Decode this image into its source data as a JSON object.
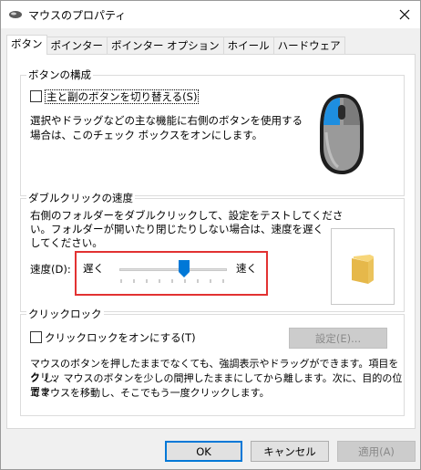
{
  "window": {
    "title": "マウスのプロパティ"
  },
  "tabs": [
    "ボタン",
    "ポインター",
    "ポインター オプション",
    "ホイール",
    "ハードウェア"
  ],
  "button_config": {
    "group_title": "ボタンの構成",
    "swap_checkbox_label": "主と副のボタンを切り替える(S)",
    "swap_checked": false,
    "description_line1": "選択やドラッグなどの主な機能に右側のボタンを使用する",
    "description_line2": "場合は、このチェック ボックスをオンにします。"
  },
  "double_click": {
    "group_title": "ダブルクリックの速度",
    "description_line1": "右側のフォルダーをダブルクリックして、設定をテストしてくださ",
    "description_line2": "い。フォルダーが開いたり閉じたりしない場合は、速度を遅く",
    "description_line3": "してください。",
    "speed_label": "速度(D):",
    "slow_label": "遅く",
    "fast_label": "速く",
    "slider_value_fraction": 0.6
  },
  "click_lock": {
    "group_title": "クリックロック",
    "checkbox_label": "クリックロックをオンにする(T)",
    "checked": false,
    "settings_button": "設定(E)...",
    "description_line1": "マウスのボタンを押したままでなくても、強調表示やドラッグができます。項目をクリッ",
    "description_line2": "ク し、マウスのボタンを少しの間押したままにしてから離します。次に、目的の位置ま",
    "description_line3": "でマウスを移動し、そこでもう一度クリックします。"
  },
  "footer": {
    "ok": "OK",
    "cancel": "キャンセル",
    "apply": "適用(A)"
  },
  "colors": {
    "accent": "#0078d7",
    "highlight": "#e23232"
  }
}
